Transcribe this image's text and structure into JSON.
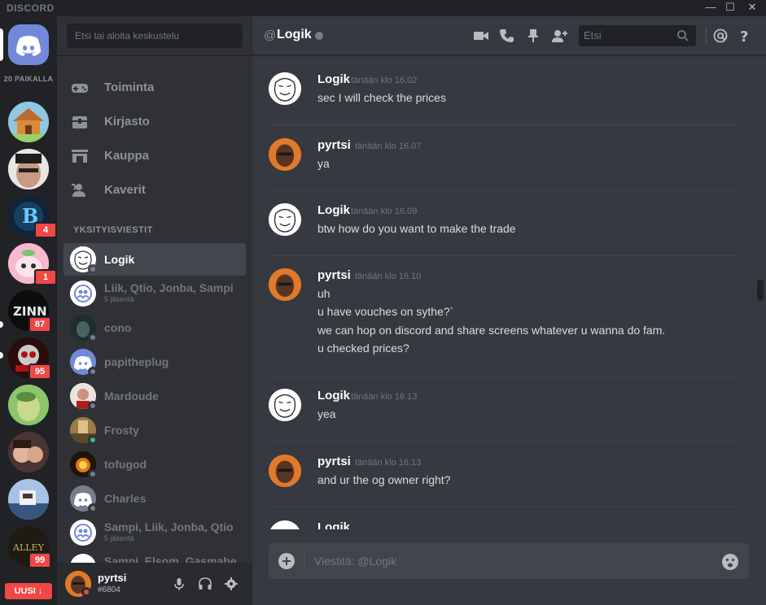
{
  "window": {
    "brand": "DISCORD",
    "minimize": "—",
    "maximize": "☐",
    "close": "✕"
  },
  "guilds": {
    "online_label": "20 PAIKALLA",
    "badges": [
      "4",
      "1",
      "87",
      "95",
      "99"
    ],
    "new_button": "UUSI ↓"
  },
  "sidebar": {
    "search_placeholder": "Etsi tai aloita keskustelu",
    "nav": [
      "Toiminta",
      "Kirjasto",
      "Kauppa",
      "Kaverit"
    ],
    "dm_header": "YKSITYISVIESTIT",
    "dms": [
      {
        "name": "Logik",
        "sub": "",
        "status": "offline"
      },
      {
        "name": "Liik, Qtio, Jonba, Sampi",
        "sub": "5 jäsentä",
        "status": "group"
      },
      {
        "name": "cono",
        "sub": "",
        "status": "offline"
      },
      {
        "name": "papitheplug",
        "sub": "",
        "status": "offline"
      },
      {
        "name": "Mardoude",
        "sub": "",
        "status": "offline"
      },
      {
        "name": "Frosty",
        "sub": "",
        "status": "online"
      },
      {
        "name": "tofugod",
        "sub": "",
        "status": "offline"
      },
      {
        "name": "Charles",
        "sub": "",
        "status": "offline"
      },
      {
        "name": "Sampi, Liik, Jonba, Qtio",
        "sub": "5 jäsentä",
        "status": "group"
      },
      {
        "name": "Sampi, Elsom, Gasmabe",
        "sub": "",
        "status": "group"
      }
    ],
    "user": {
      "name": "pyrtsi",
      "tag": "#6804"
    }
  },
  "chat": {
    "at": "@",
    "channel": "Logik",
    "search_placeholder": "Etsi",
    "composer_placeholder": "Viestitä: @Logik",
    "messages": [
      {
        "author": "Logik",
        "time": "tänään klo 16.02",
        "lines": [
          "sec I will check the prices"
        ]
      },
      {
        "author": "pyrtsi",
        "time": "tänään klo 16.07",
        "lines": [
          "ya"
        ]
      },
      {
        "author": "Logik",
        "time": "tänään klo 16.09",
        "lines": [
          "btw how do you want to make the trade"
        ]
      },
      {
        "author": "pyrtsi",
        "time": "tänään klo 16.10",
        "lines": [
          "uh",
          "u have vouches on sythe?`",
          "we can hop on discord and share screens whatever u wanna do fam.",
          "u checked prices?"
        ]
      },
      {
        "author": "Logik",
        "time": "tänään klo 16.13",
        "lines": [
          "yea"
        ]
      },
      {
        "author": "pyrtsi",
        "time": "tänään klo 16.13",
        "lines": [
          "and ur the og owner right?"
        ]
      },
      {
        "author": "Logik",
        "time": "",
        "lines": []
      }
    ]
  },
  "colors": {
    "blurple": "#7289da",
    "danger": "#f04747",
    "online": "#43b581",
    "offline": "#747f8d"
  }
}
